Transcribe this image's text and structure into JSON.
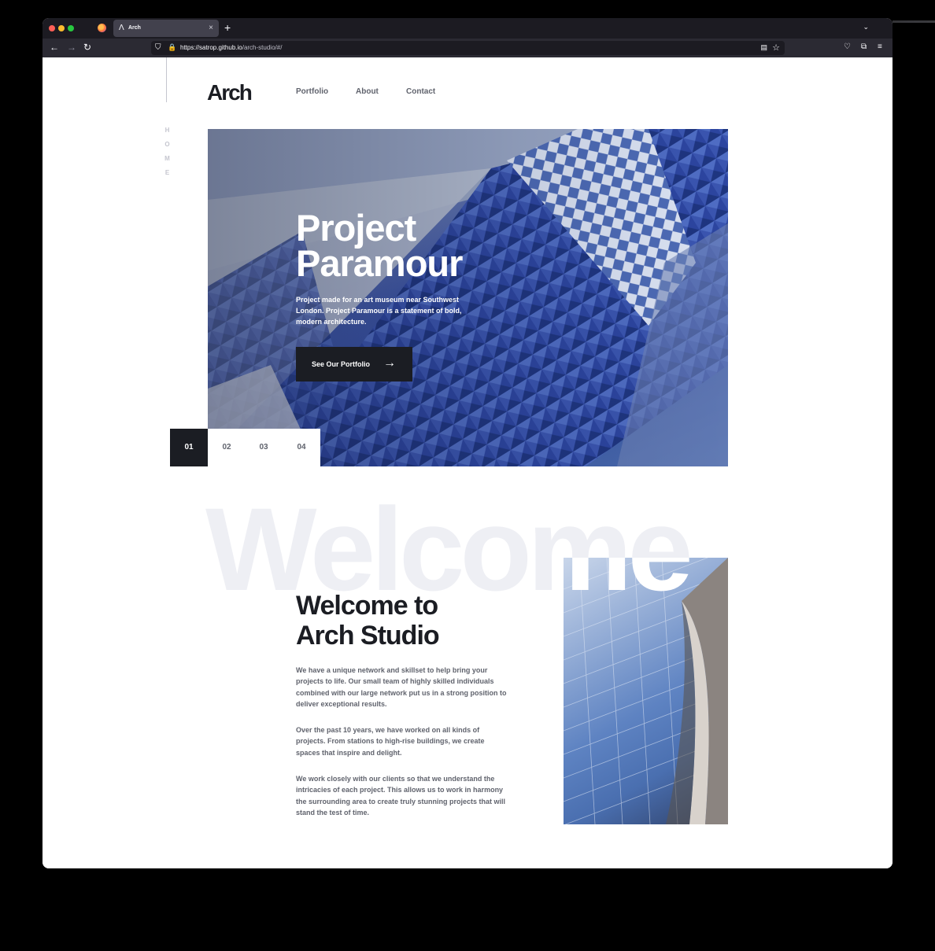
{
  "browser": {
    "tab_title": "Arch",
    "tab_icon": "Λ",
    "tab_close": "×",
    "new_tab": "+",
    "tab_list": "⌄",
    "url_host": "https://satrop.github.io",
    "url_path": "/arch-studio/#/",
    "back": "←",
    "forward": "→",
    "reload": "↻",
    "shield": "⛉",
    "lock": "🔒",
    "reader": "▤",
    "bookmark": "☆",
    "pocket": "♡",
    "extensions": "⧉",
    "menu": "≡"
  },
  "site": {
    "logo": "Arch",
    "side_label": "HOME",
    "nav": [
      "Portfolio",
      "About",
      "Contact"
    ]
  },
  "hero": {
    "title_line1": "Project",
    "title_line2": "Paramour",
    "description": "Project made for an art museum near Southwest London. Project Paramour is a statement of bold, modern architecture.",
    "cta_label": "See Our Portfolio",
    "cta_arrow": "→",
    "slides": [
      "01",
      "02",
      "03",
      "04"
    ],
    "active_slide": "01"
  },
  "welcome": {
    "background_word": "Welcome",
    "title_line1": "Welcome to",
    "title_line2": "Arch Studio",
    "paragraphs": [
      "We have a unique network and skillset to help bring your projects to life. Our small team of highly skilled individuals combined with our large network put us in a strong position to deliver exceptional results.",
      "Over the past 10 years, we have worked on all kinds of projects. From stations to high-rise buildings, we create spaces that inspire and delight.",
      "We work closely with our clients so that we understand the intricacies of each project. This allows us to work in harmony the surrounding area to create truly stunning projects that will stand the test of time."
    ]
  },
  "colors": {
    "dark": "#1b1d23",
    "gray": "#60636d",
    "light_gray": "#eeeff4",
    "tab_bar": "#1c1b22",
    "nav_bar": "#2b2a33"
  }
}
